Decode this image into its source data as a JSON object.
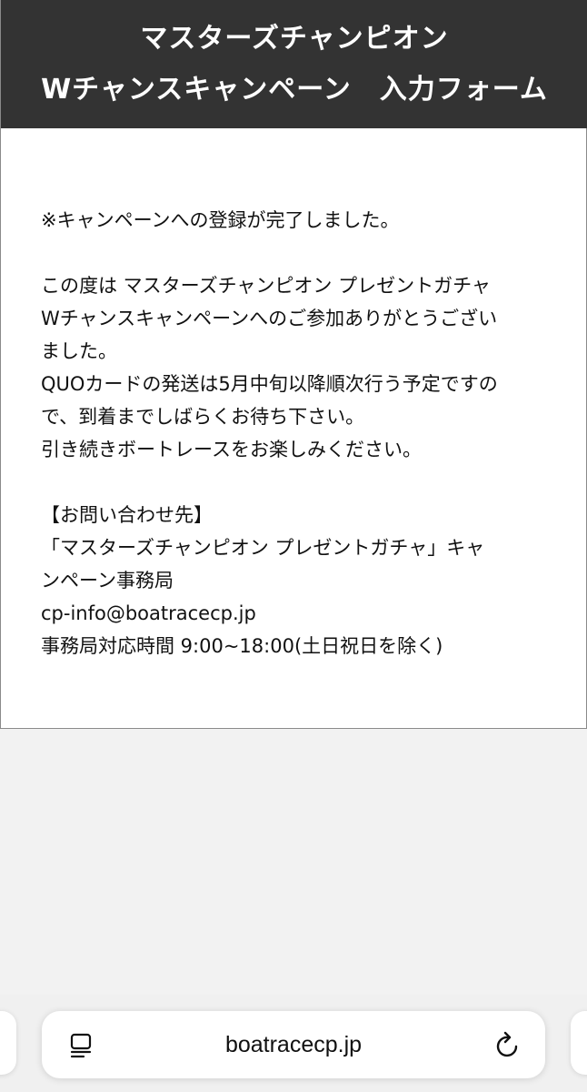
{
  "header": {
    "line1": "マスターズチャンピオン",
    "line2": "Wチャンスキャンペーン　入力フォーム"
  },
  "message": {
    "complete": "※キャンペーンへの登録が完了しました。",
    "thanks_1": "この度は マスターズチャンピオン プレゼントガチャ",
    "thanks_2": "Wチャンスキャンペーンへのご参加ありがとうござい",
    "thanks_3": "ました。",
    "shipping_1": "QUOカードの発送は5月中旬以降順次行う予定ですの",
    "shipping_2": "で、到着までしばらくお待ち下さい。",
    "enjoy": "引き続きボートレースをお楽しみください。",
    "contact_heading": "【お問い合わせ先】",
    "contact_org_1": "「マスターズチャンピオン プレゼントガチャ」キャ",
    "contact_org_2": "ンペーン事務局",
    "contact_email": "cp-info@boatracecp.jp",
    "contact_hours": "事務局対応時間 9:00~18:00(土日祝日を除く)"
  },
  "browser": {
    "url": "boatracecp.jp",
    "left_icon": "reader-icon",
    "right_icon": "reload-icon"
  },
  "colors": {
    "header_bg": "#333333",
    "header_text": "#ffffff",
    "page_bg": "#f2f2f2"
  }
}
